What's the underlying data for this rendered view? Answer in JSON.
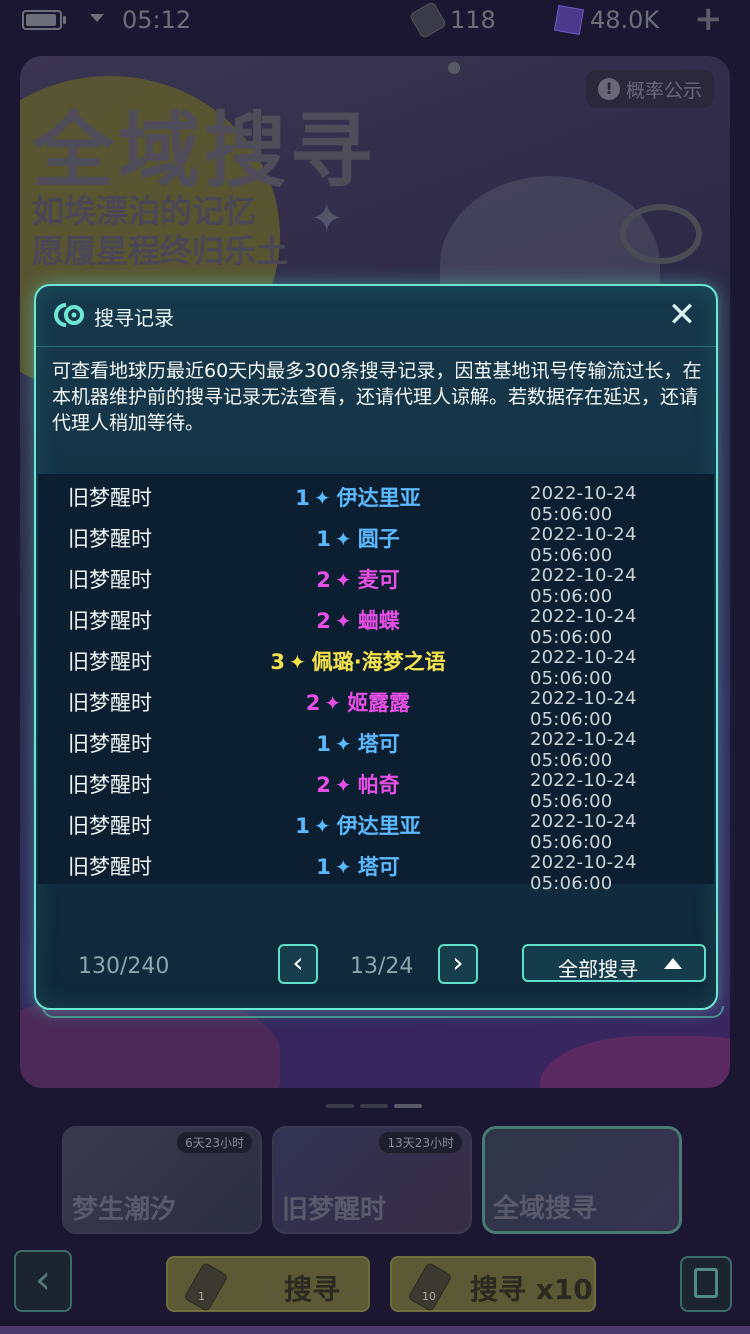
{
  "status_bar": {
    "time": "05:12",
    "tickets": "118",
    "currency": "48.0K"
  },
  "banner": {
    "title": "全域搜寻",
    "subtitle_1": "如埃漂泊的记忆",
    "subtitle_2": "愿履星程终归乐土",
    "probability_label": "概率公示"
  },
  "dialog": {
    "title": "搜寻记录",
    "description": "可查看地球历最近60天内最多300条搜寻记录，因茧基地讯号传输流过长，在本机器维护前的搜寻记录无法查看，还请代理人谅解。若数据存在延迟，还请代理人稍加等待。",
    "records": [
      {
        "name": "旧梦醒时",
        "rarity": "1",
        "item": "伊达里亚",
        "time": "2022-10-24 05:06:00"
      },
      {
        "name": "旧梦醒时",
        "rarity": "1",
        "item": "圆子",
        "time": "2022-10-24 05:06:00"
      },
      {
        "name": "旧梦醒时",
        "rarity": "2",
        "item": "麦可",
        "time": "2022-10-24 05:06:00"
      },
      {
        "name": "旧梦醒时",
        "rarity": "2",
        "item": "蛐蝶",
        "time": "2022-10-24 05:06:00"
      },
      {
        "name": "旧梦醒时",
        "rarity": "3",
        "item": "佩璐·海梦之语",
        "time": "2022-10-24 05:06:00"
      },
      {
        "name": "旧梦醒时",
        "rarity": "2",
        "item": "姬露露",
        "time": "2022-10-24 05:06:00"
      },
      {
        "name": "旧梦醒时",
        "rarity": "1",
        "item": "塔可",
        "time": "2022-10-24 05:06:00"
      },
      {
        "name": "旧梦醒时",
        "rarity": "2",
        "item": "帕奇",
        "time": "2022-10-24 05:06:00"
      },
      {
        "name": "旧梦醒时",
        "rarity": "1",
        "item": "伊达里亚",
        "time": "2022-10-24 05:06:00"
      },
      {
        "name": "旧梦醒时",
        "rarity": "1",
        "item": "塔可",
        "time": "2022-10-24 05:06:00"
      }
    ],
    "counter": "130/240",
    "page": "13/24",
    "filter_label": "全部搜寻"
  },
  "rarity_colors": {
    "1": "#5cb9ff",
    "2": "#e84fe6",
    "3": "#f6e24b"
  },
  "pools": [
    {
      "title": "梦生潮汐",
      "timer": "6天23小时"
    },
    {
      "title": "旧梦醒时",
      "timer": "13天23小时"
    },
    {
      "title": "全域搜寻",
      "timer": ""
    }
  ],
  "actions": {
    "single_label": "搜寻",
    "single_count": "1",
    "multi_label": "搜寻 x10",
    "multi_count": "10"
  }
}
